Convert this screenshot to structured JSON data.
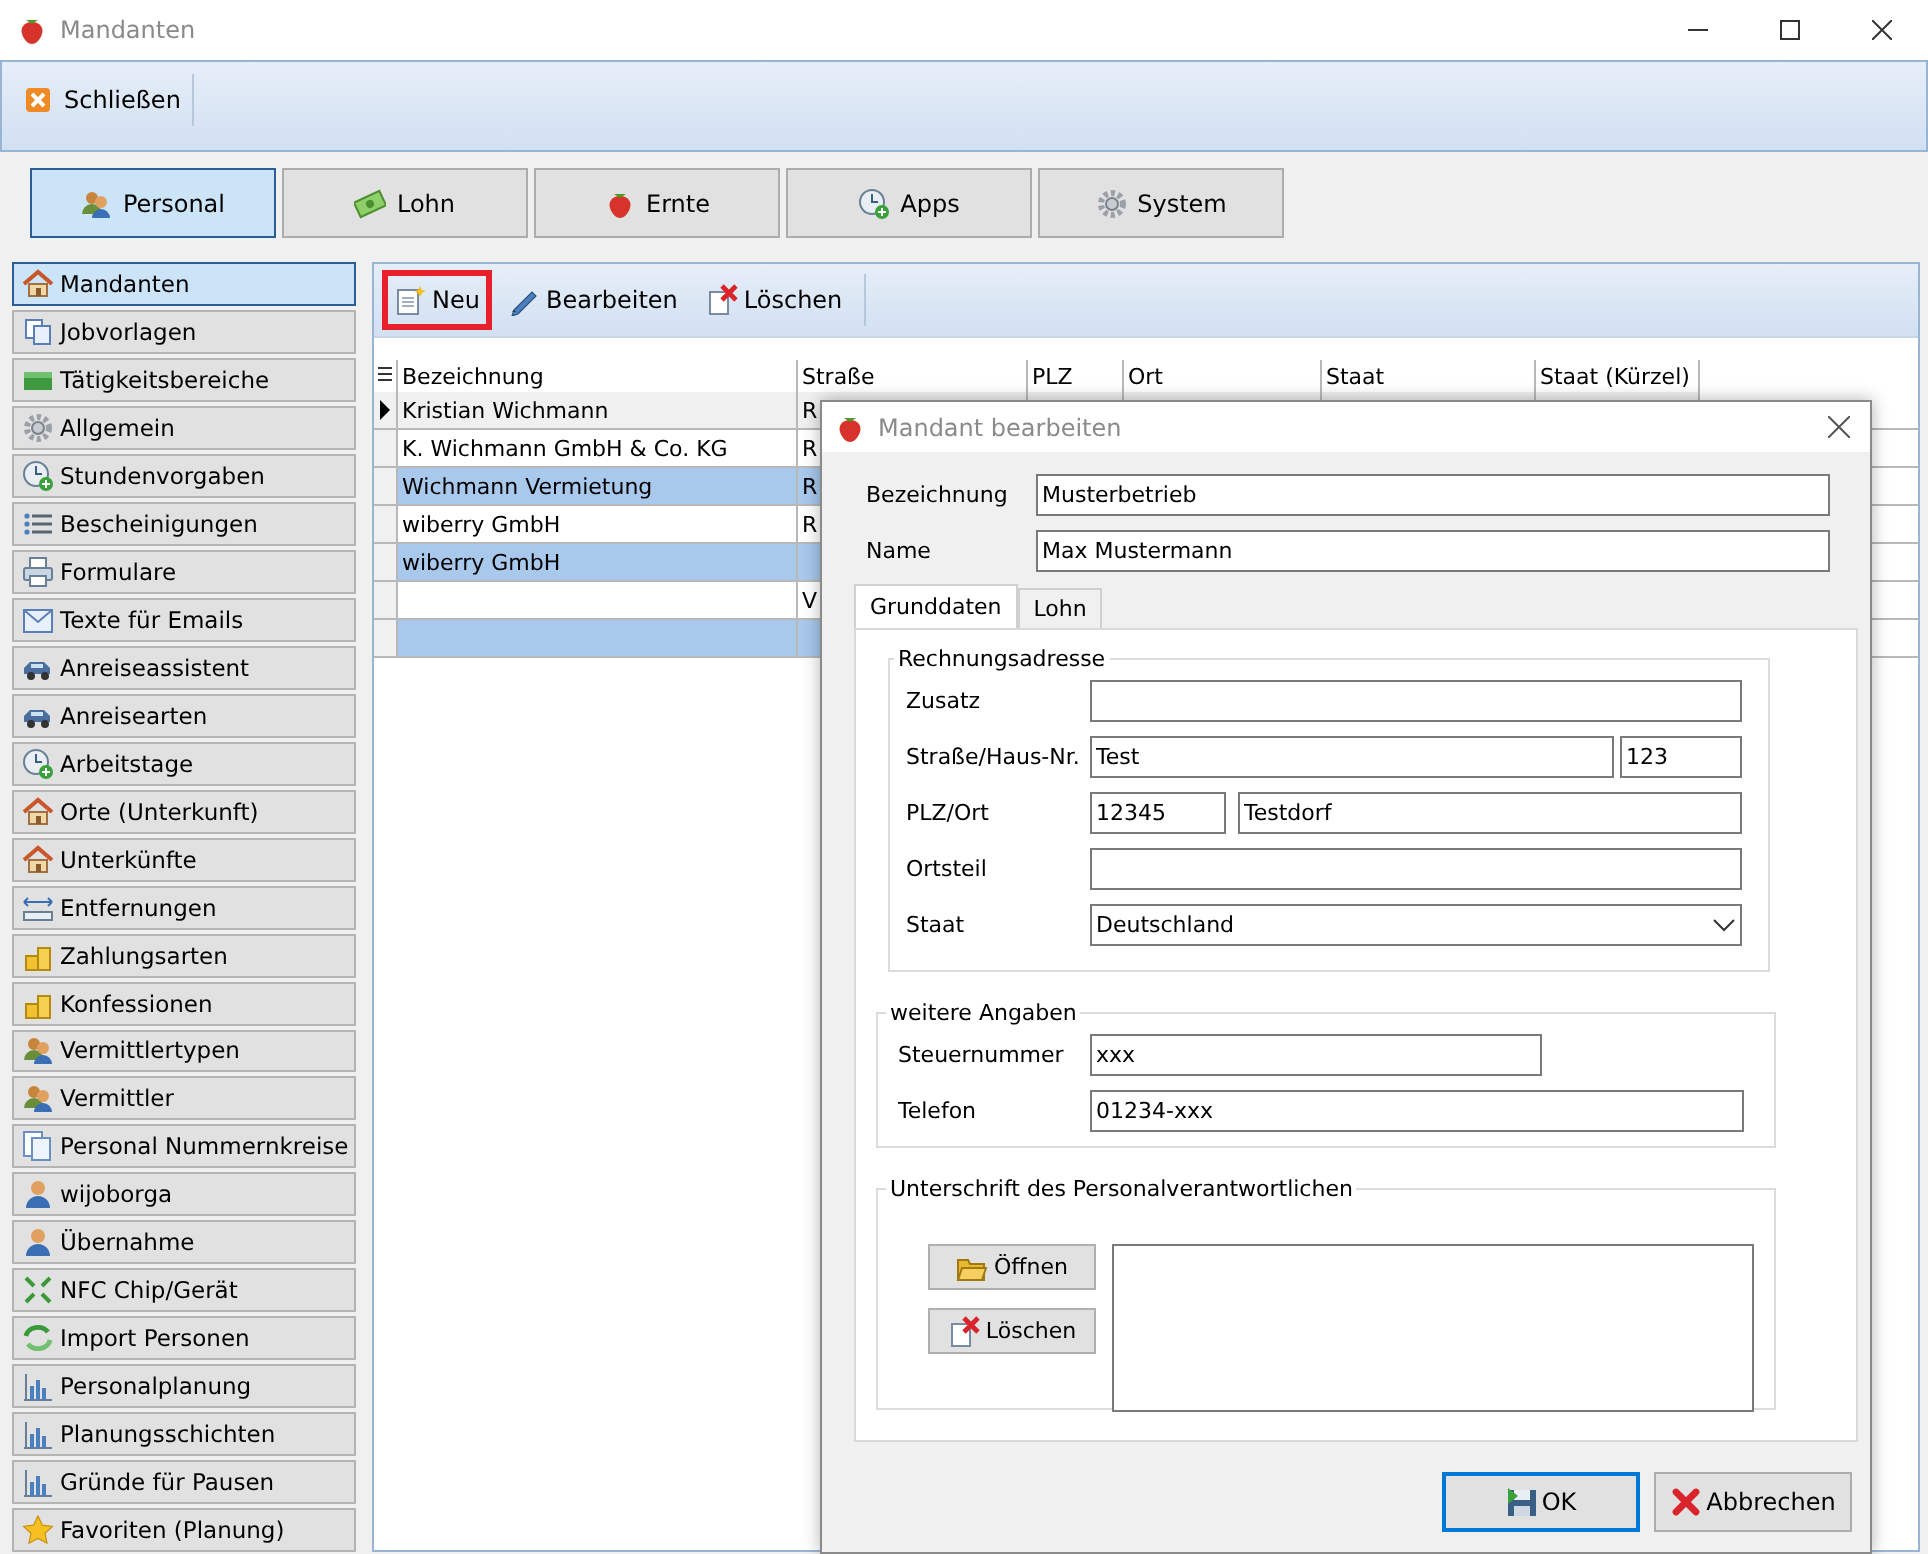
{
  "window": {
    "title": "Mandanten"
  },
  "ribbon": {
    "buttons": [
      {
        "label": "Schließen"
      }
    ]
  },
  "modules": [
    {
      "label": "Personal",
      "selected": true
    },
    {
      "label": "Lohn",
      "selected": false
    },
    {
      "label": "Ernte",
      "selected": false
    },
    {
      "label": "Apps",
      "selected": false
    },
    {
      "label": "System",
      "selected": false
    }
  ],
  "sidebar": {
    "items": [
      {
        "label": "Mandanten",
        "selected": true
      },
      {
        "label": "Jobvorlagen",
        "selected": false
      },
      {
        "label": "Tätigkeitsbereiche",
        "selected": false
      },
      {
        "label": "Allgemein",
        "selected": false
      },
      {
        "label": "Stundenvorgaben",
        "selected": false
      },
      {
        "label": "Bescheinigungen",
        "selected": false
      },
      {
        "label": "Formulare",
        "selected": false
      },
      {
        "label": "Texte für Emails",
        "selected": false
      },
      {
        "label": "Anreiseassistent",
        "selected": false
      },
      {
        "label": "Anreisearten",
        "selected": false
      },
      {
        "label": "Arbeitstage",
        "selected": false
      },
      {
        "label": "Orte (Unterkunft)",
        "selected": false
      },
      {
        "label": "Unterkünfte",
        "selected": false
      },
      {
        "label": "Entfernungen",
        "selected": false
      },
      {
        "label": "Zahlungsarten",
        "selected": false
      },
      {
        "label": "Konfessionen",
        "selected": false
      },
      {
        "label": "Vermittlertypen",
        "selected": false
      },
      {
        "label": "Vermittler",
        "selected": false
      },
      {
        "label": "Personal Nummernkreise",
        "selected": false
      },
      {
        "label": "wijoborga",
        "selected": false
      },
      {
        "label": "Übernahme",
        "selected": false
      },
      {
        "label": "NFC Chip/Gerät",
        "selected": false
      },
      {
        "label": "Import Personen",
        "selected": false
      },
      {
        "label": "Personalplanung",
        "selected": false
      },
      {
        "label": "Planungsschichten",
        "selected": false
      },
      {
        "label": "Gründe für Pausen",
        "selected": false
      },
      {
        "label": "Favoriten (Planung)",
        "selected": false
      }
    ]
  },
  "actions": [
    {
      "label": "Neu",
      "highlighted": true
    },
    {
      "label": "Bearbeiten",
      "highlighted": false
    },
    {
      "label": "Löschen",
      "highlighted": false
    }
  ],
  "table": {
    "columns": [
      "Bezeichnung",
      "Straße",
      "PLZ",
      "Ort",
      "Staat",
      "Staat (Kürzel)"
    ],
    "rows": [
      {
        "cells": [
          "Kristian Wichmann",
          "R"
        ],
        "selected": false,
        "current": true
      },
      {
        "cells": [
          "K. Wichmann GmbH & Co. KG",
          "R"
        ],
        "selected": false,
        "current": false
      },
      {
        "cells": [
          "Wichmann Vermietung",
          "R"
        ],
        "selected": true,
        "current": false
      },
      {
        "cells": [
          "wiberry GmbH",
          "R"
        ],
        "selected": false,
        "current": false
      },
      {
        "cells": [
          "wiberry GmbH"
        ],
        "selected": true,
        "current": false
      },
      {
        "cells": [
          "",
          "V"
        ],
        "selected": false,
        "current": false
      },
      {
        "cells": [],
        "selected": true,
        "current": false
      }
    ]
  },
  "dialog": {
    "title": "Mandant bearbeiten",
    "fields": [
      {
        "label": "Bezeichnung",
        "value": "Musterbetrieb"
      },
      {
        "label": "Name",
        "value": "Max Mustermann"
      }
    ],
    "tabs": [
      {
        "label": "Grunddaten",
        "selected": true
      },
      {
        "label": "Lohn",
        "selected": false
      }
    ],
    "address": {
      "legend": "Rechnungsadresse",
      "rows": [
        {
          "label": "Zusatz",
          "kind": "text"
        },
        {
          "label": "Straße/Haus-Nr.",
          "kind": "street",
          "values": [
            "Test",
            "123"
          ]
        },
        {
          "label": "PLZ/Ort",
          "kind": "city",
          "values": [
            "12345",
            "Testdorf"
          ]
        },
        {
          "label": "Ortsteil",
          "kind": "text"
        },
        {
          "label": "Staat",
          "kind": "select",
          "values": [
            "Deutschland"
          ]
        }
      ]
    },
    "more": {
      "legend": "weitere Angaben",
      "rows": [
        {
          "label": "Steuernummer",
          "kind": "short",
          "value": "xxx"
        },
        {
          "label": "Telefon",
          "kind": "text",
          "value": "01234-xxx"
        }
      ]
    },
    "signature": {
      "legend": "Unterschrift des Personalverantwortlichen",
      "buttons": [
        {
          "label": "Öffnen"
        },
        {
          "label": "Löschen"
        }
      ]
    },
    "buttons": [
      {
        "label": "OK",
        "default": true
      },
      {
        "label": "Abbrechen",
        "default": false
      }
    ]
  }
}
